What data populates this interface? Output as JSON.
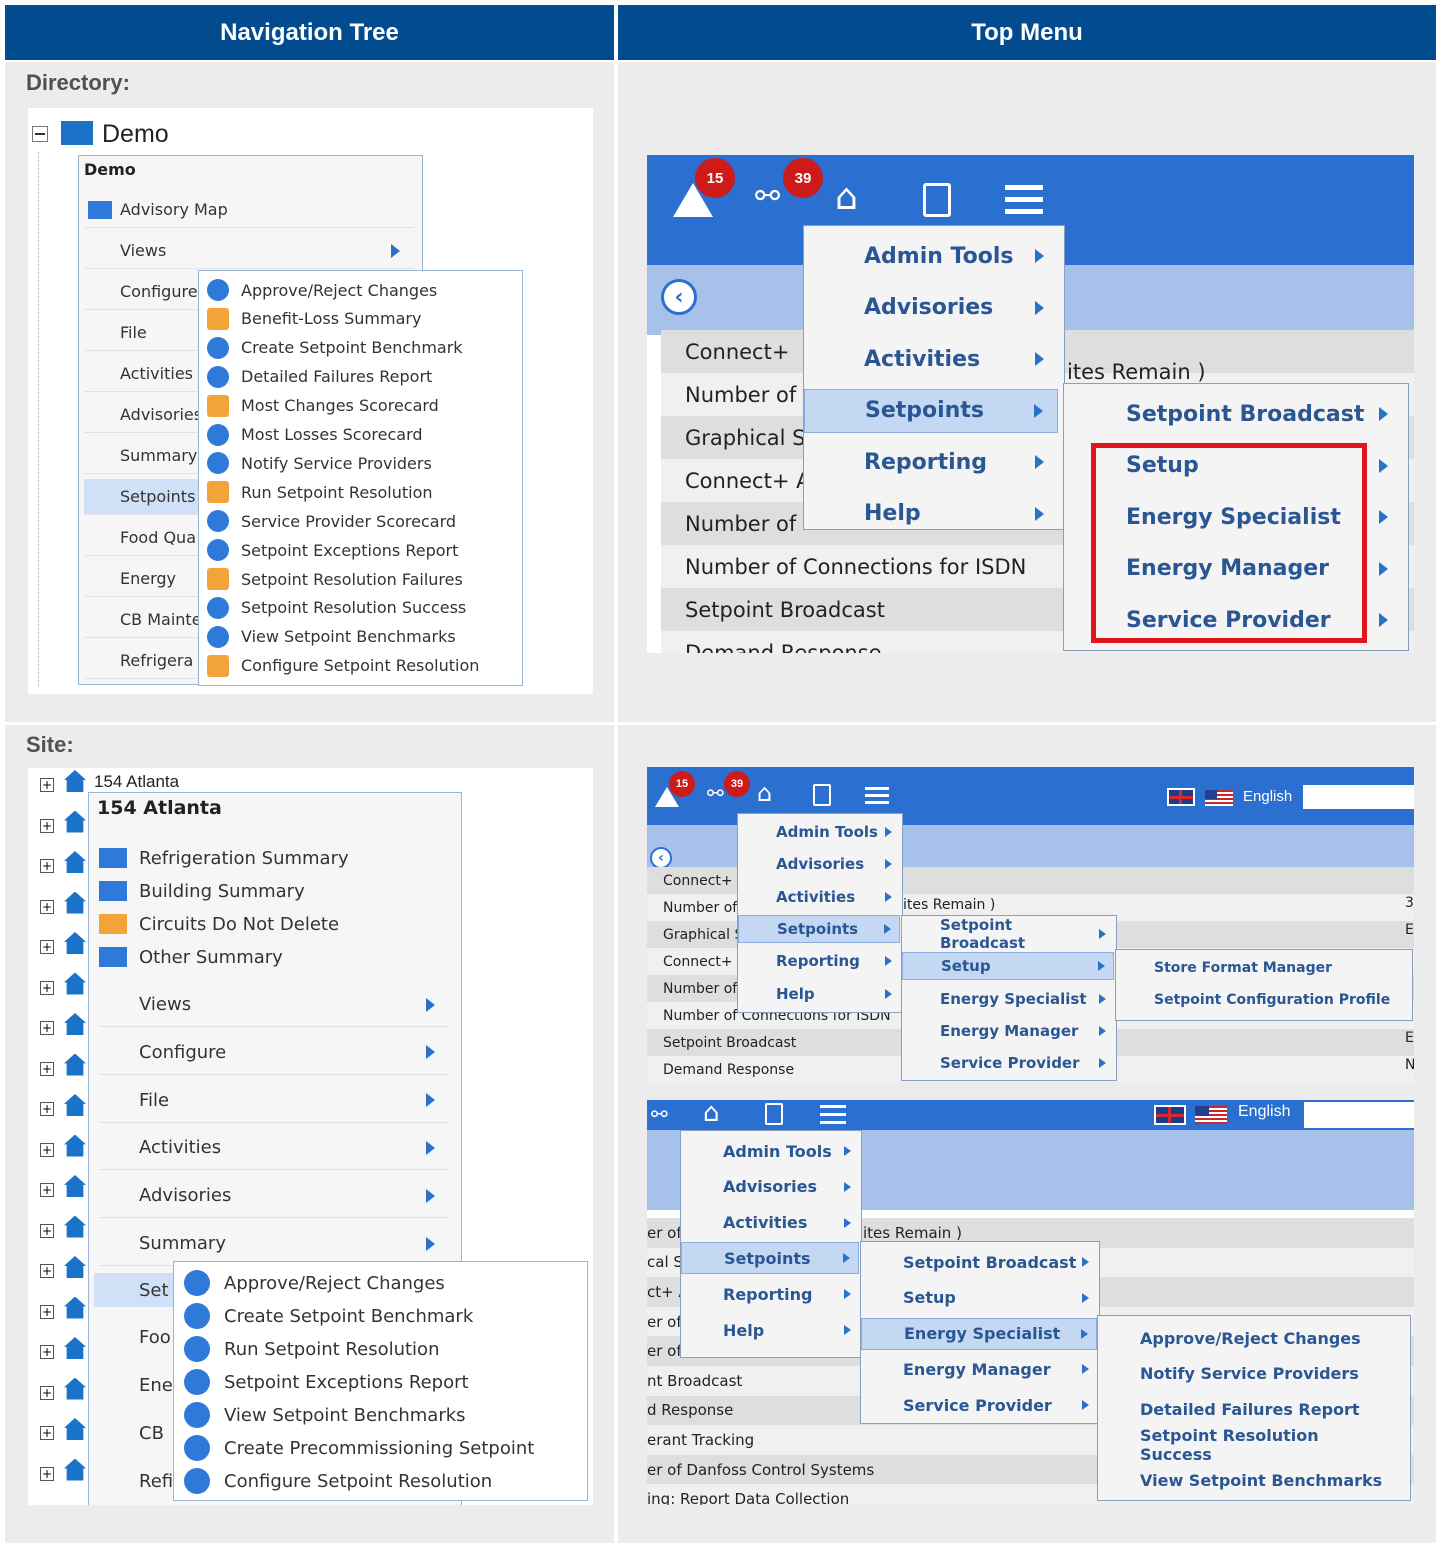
{
  "headers": {
    "left": "Navigation Tree",
    "right": "Top Menu"
  },
  "labels": {
    "directory": "Directory:",
    "site": "Site:"
  },
  "dir": {
    "root": "Demo",
    "menu_title": "Demo",
    "menu_items": [
      "Advisory Map",
      "Views",
      "Configure",
      "File",
      "Activities",
      "Advisories",
      "Summary",
      "Setpoints",
      "Food Qua",
      "Energy",
      "CB Mainte",
      "Refrigera"
    ],
    "submenu": [
      "Approve/Reject Changes",
      "Benefit-Loss Summary",
      "Create Setpoint Benchmark",
      "Detailed Failures Report",
      "Most Changes Scorecard",
      "Most Losses Scorecard",
      "Notify Service Providers",
      "Run Setpoint Resolution",
      "Service Provider Scorecard",
      "Setpoint Exceptions Report",
      "Setpoint Resolution Failures",
      "Setpoint Resolution Success",
      "View Setpoint Benchmarks",
      "Configure Setpoint Resolution"
    ]
  },
  "site": {
    "root": "154 Atlanta",
    "menu_title": "154 Atlanta",
    "summaries": [
      "Refrigeration Summary",
      "Building Summary",
      "Circuits Do Not Delete",
      "Other Summary"
    ],
    "menu_items": [
      "Views",
      "Configure",
      "File",
      "Activities",
      "Advisories",
      "Summary"
    ],
    "partial_items": [
      "Set",
      "Foo",
      "Ene",
      "CB",
      "Refi"
    ],
    "submenu": [
      "Approve/Reject Changes",
      "Create Setpoint Benchmark",
      "Run Setpoint Resolution",
      "Setpoint Exceptions Report",
      "View Setpoint Benchmarks",
      "Create Precommissioning Setpoint",
      "Configure Setpoint Resolution"
    ]
  },
  "top1": {
    "badge_alert": "15",
    "badge_link": "39",
    "menu": [
      "Admin Tools",
      "Advisories",
      "Activities",
      "Setpoints",
      "Reporting",
      "Help"
    ],
    "submenu": [
      "Setpoint Broadcast",
      "Setup",
      "Energy Specialist",
      "Energy Manager",
      "Service Provider"
    ],
    "rows": [
      "Connect+",
      "Number of",
      "Graphical S",
      "Connect+ A",
      "Number of",
      "Number of Connections for ISDN",
      "Setpoint Broadcast",
      "Demand Response"
    ],
    "row_tail": "ites Remain )"
  },
  "top2": {
    "badge_alert": "15",
    "badge_link": "39",
    "language": "English",
    "menu": [
      "Admin Tools",
      "Advisories",
      "Activities",
      "Setpoints",
      "Reporting",
      "Help"
    ],
    "submenu": [
      "Setpoint Broadcast",
      "Setup",
      "Energy Specialist",
      "Energy Manager",
      "Service Provider"
    ],
    "subsub": [
      "Store Format Manager",
      "Setpoint Configuration Profile"
    ],
    "rows": [
      "Connect+",
      "Number of",
      "Graphical S",
      "Connect+ A",
      "Number of",
      "Number of Connections for ISDN",
      "Setpoint Broadcast",
      "Demand Response"
    ],
    "row_tail": "ites Remain )",
    "right_vals": [
      "3:",
      "E",
      "E",
      "N"
    ]
  },
  "top3": {
    "language": "English",
    "menu": [
      "Admin Tools",
      "Advisories",
      "Activities",
      "Setpoints",
      "Reporting",
      "Help"
    ],
    "submenu": [
      "Setpoint Broadcast",
      "Setup",
      "Energy Specialist",
      "Energy Manager",
      "Service Provider"
    ],
    "subsub": [
      "Approve/Reject Changes",
      "Notify Service Providers",
      "Detailed Failures Report",
      "Setpoint Resolution Success",
      "View Setpoint Benchmarks"
    ],
    "rows": [
      "er of",
      "cal S",
      "ct+ A",
      "er of",
      "er of Connections for ISDN",
      "nt Broadcast",
      "d Response",
      "erant Tracking",
      "er of Danfoss Control Systems",
      "ing: Report Data Collection"
    ],
    "row_tail": "ites Remain )"
  }
}
